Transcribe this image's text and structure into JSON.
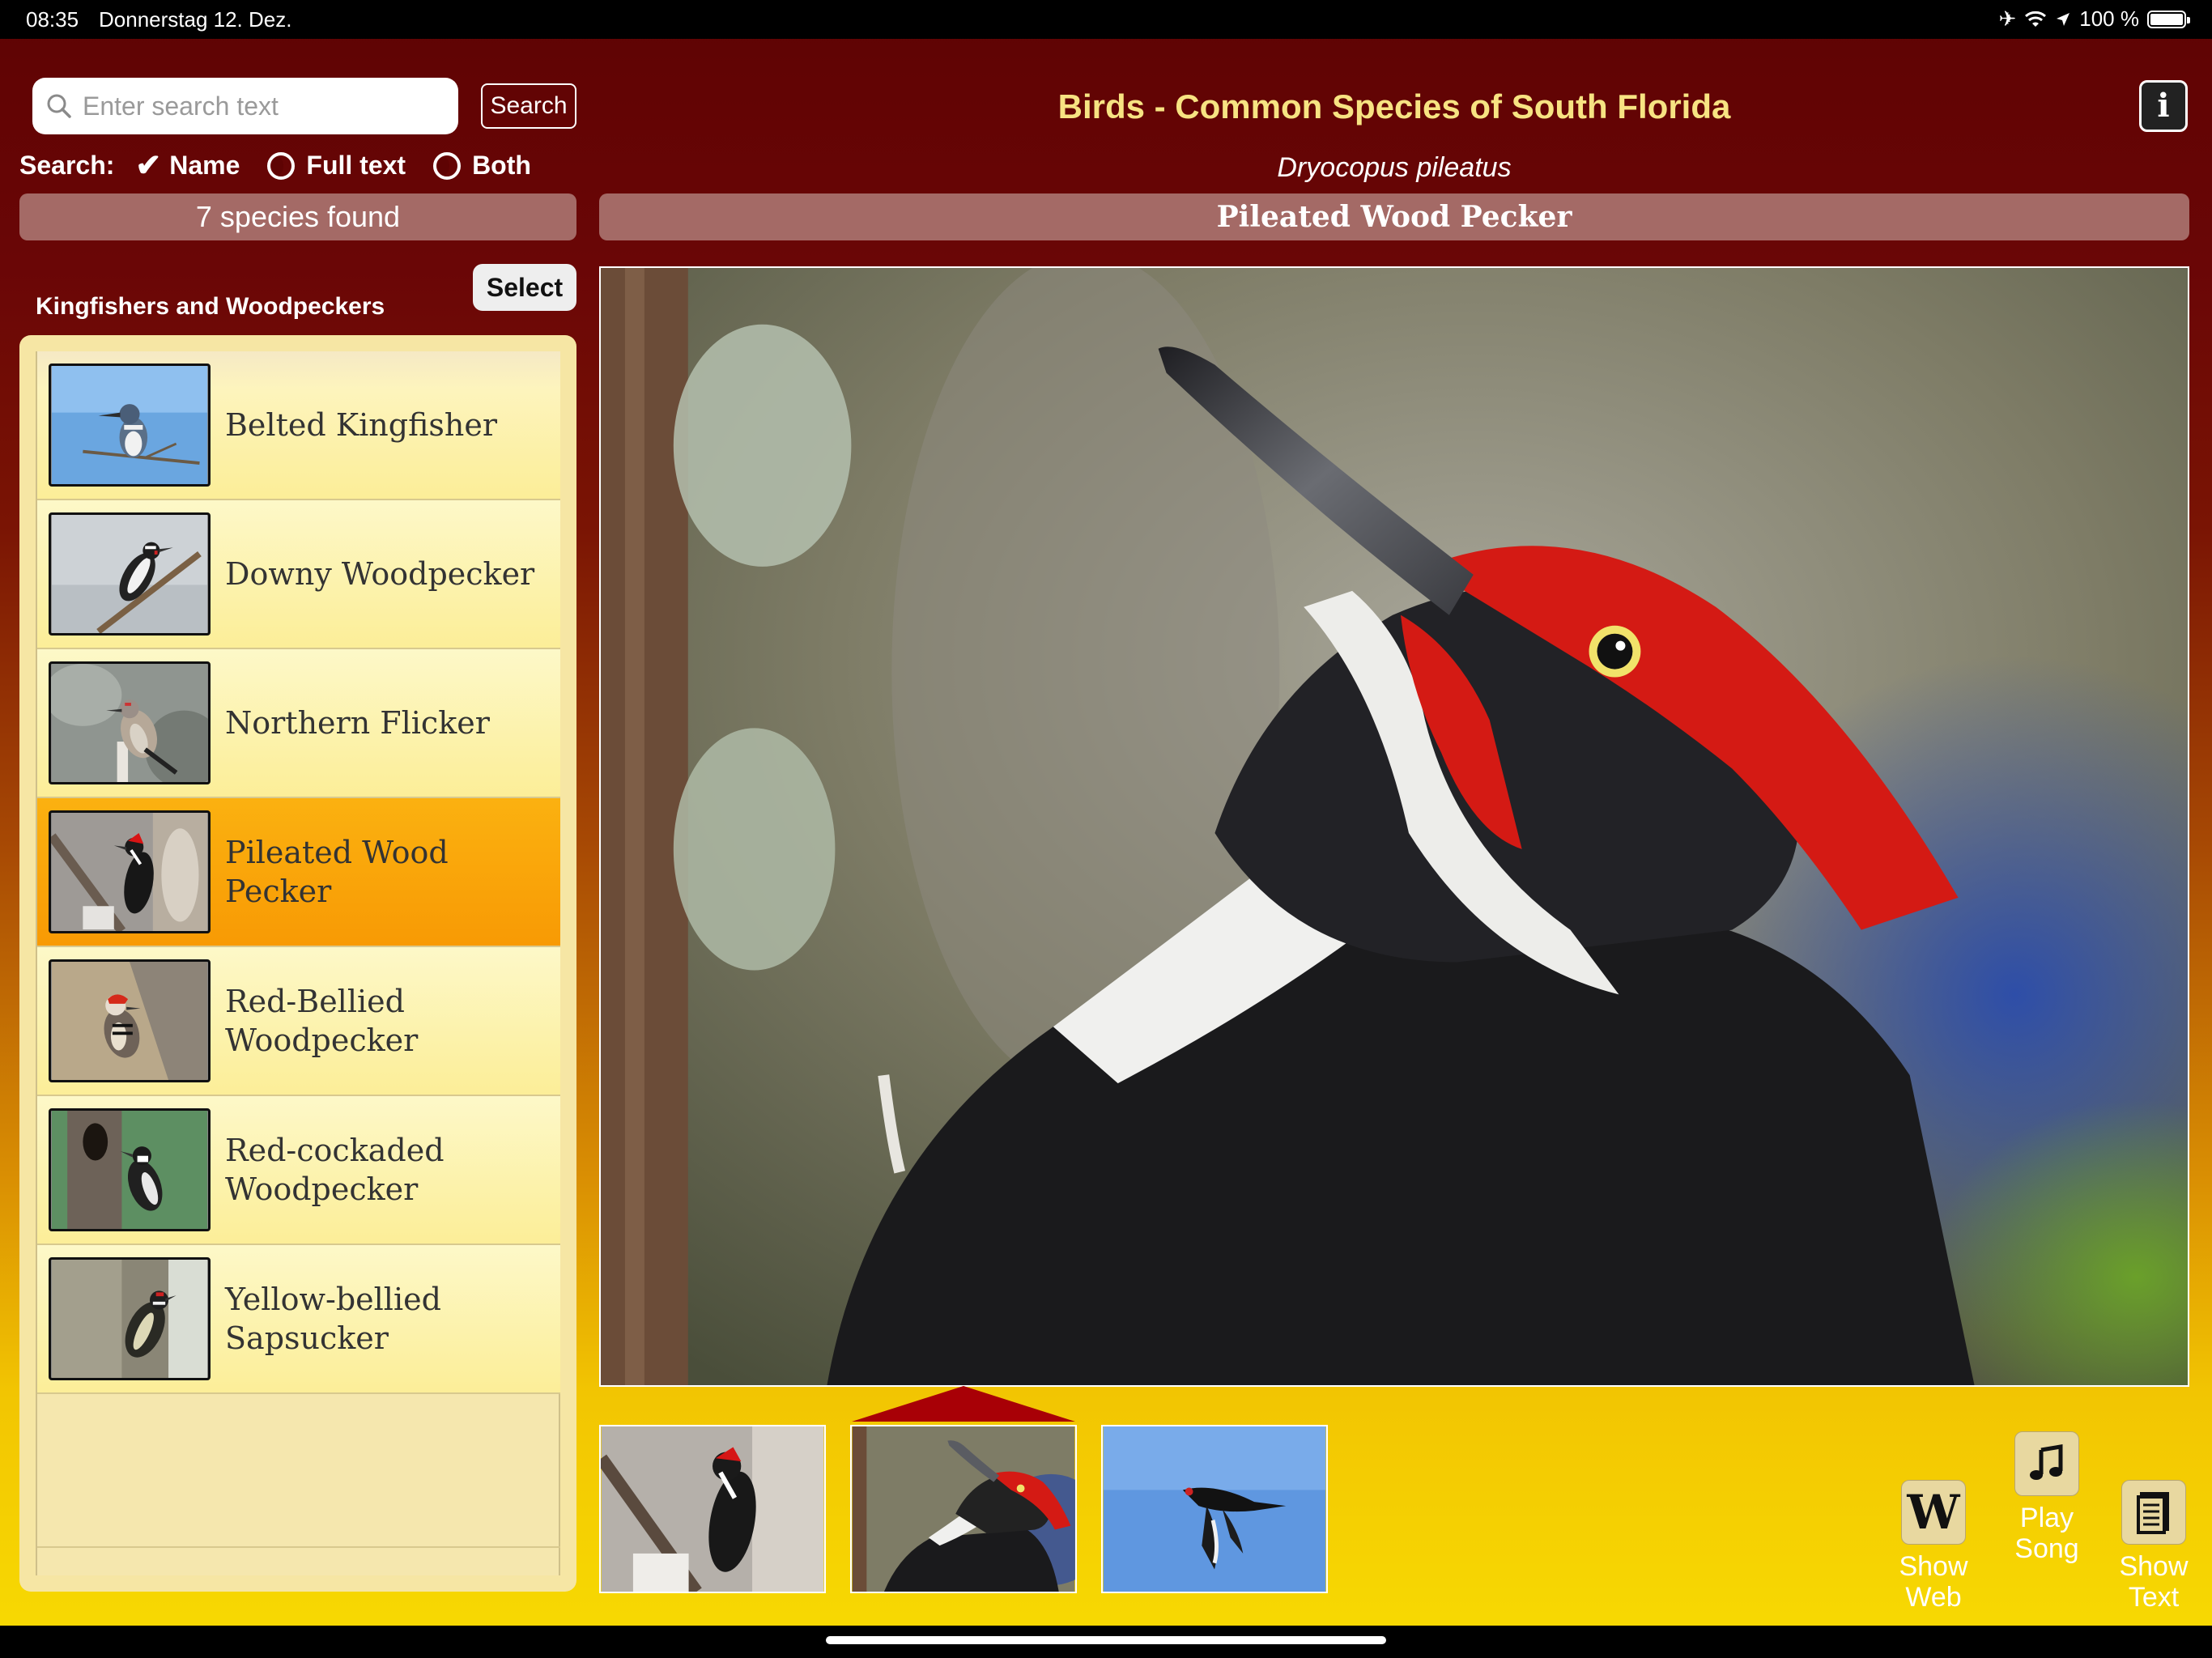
{
  "status_bar": {
    "time": "08:35",
    "date": "Donnerstag 12. Dez.",
    "battery": "100 %"
  },
  "search": {
    "placeholder": "Enter search text",
    "button": "Search",
    "label": "Search:",
    "options": [
      "Name",
      "Full text",
      "Both"
    ],
    "selected_option": "Name"
  },
  "results": {
    "count_text": "7 species found",
    "group_title": "Kingfishers and Woodpeckers",
    "select_button": "Select",
    "items": [
      {
        "name": "Belted Kingfisher"
      },
      {
        "name": "Downy Woodpecker"
      },
      {
        "name": "Northern Flicker"
      },
      {
        "name": "Pileated Wood Pecker"
      },
      {
        "name": "Red-Bellied Woodpecker"
      },
      {
        "name": "Red-cockaded Woodpecker"
      },
      {
        "name": "Yellow-bellied Sapsucker"
      }
    ],
    "selected_index": 3
  },
  "header": {
    "app_title": "Birds - Common Species of South Florida",
    "info_button": "i",
    "scientific_name": "Dryocopus pileatus",
    "common_name": "Pileated Wood Pecker"
  },
  "gallery": {
    "selected_thumb": 1
  },
  "actions": {
    "show_web": "Show Web",
    "play_song": "Play Song",
    "show_text": "Show Text"
  },
  "colors": {
    "background_top": "#5e0303",
    "background_bottom": "#f7d802",
    "title_yellow": "#f7e382",
    "selected_item": "#f89a04",
    "bar_mauve": "#a46a66",
    "thumb_marker": "#a80006"
  }
}
